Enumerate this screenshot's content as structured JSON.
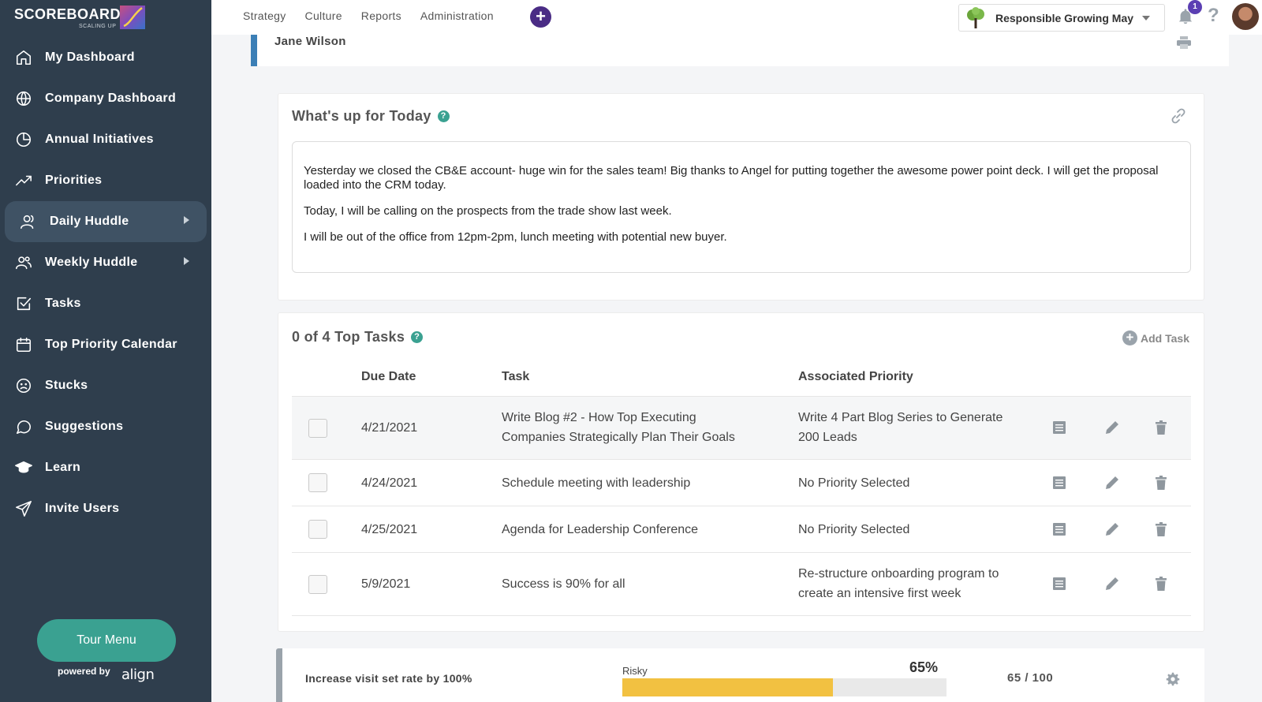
{
  "app": {
    "name": "SCOREBOARD",
    "sub": "SCALING UP",
    "powered_by": "powered by",
    "powered_brand": "align"
  },
  "sidebar": {
    "items": [
      {
        "label": "My Dashboard",
        "icon": "home-icon"
      },
      {
        "label": "Company Dashboard",
        "icon": "globe-icon"
      },
      {
        "label": "Annual Initiatives",
        "icon": "pie-chart-icon"
      },
      {
        "label": "Priorities",
        "icon": "trending-up-icon"
      },
      {
        "label": "Daily Huddle",
        "icon": "user-icon",
        "active": true,
        "expandable": true
      },
      {
        "label": "Weekly Huddle",
        "icon": "users-icon",
        "expandable": true
      },
      {
        "label": "Tasks",
        "icon": "checkbox-icon"
      },
      {
        "label": "Top Priority Calendar",
        "icon": "calendar-icon"
      },
      {
        "label": "Stucks",
        "icon": "frown-icon"
      },
      {
        "label": "Suggestions",
        "icon": "chat-icon"
      },
      {
        "label": "Learn",
        "icon": "graduation-cap-icon"
      },
      {
        "label": "Invite Users",
        "icon": "send-icon"
      }
    ],
    "tour_button": "Tour Menu"
  },
  "topbar": {
    "nav": [
      "Strategy",
      "Culture",
      "Reports",
      "Administration"
    ],
    "company": "Responsible Growing May",
    "notifications": "1",
    "help": "?"
  },
  "header": {
    "name": "Jane Wilson"
  },
  "today": {
    "title": "What's up for Today",
    "help": "?",
    "paragraphs": [
      "Yesterday we closed the CB&E account- huge win for the sales team! Big thanks to Angel for putting together the awesome power point deck. I will get the proposal loaded into the CRM today.",
      "Today, I will be calling on the prospects from the trade show last week.",
      "I will be out of the office from 12pm-2pm, lunch meeting with potential new buyer."
    ]
  },
  "tasks": {
    "title": "0 of 4 Top Tasks",
    "help": "?",
    "add_label": "Add Task",
    "columns": {
      "due": "Due Date",
      "task": "Task",
      "priority": "Associated Priority"
    },
    "rows": [
      {
        "due": "4/21/2021",
        "task": "Write Blog #2 - How Top Executing Companies Strategically Plan Their Goals",
        "priority": "Write 4 Part Blog Series to Generate 200 Leads"
      },
      {
        "due": "4/24/2021",
        "task": "Schedule meeting with leadership",
        "priority": "No Priority Selected"
      },
      {
        "due": "4/25/2021",
        "task": "Agenda for Leadership Conference",
        "priority": "No Priority Selected"
      },
      {
        "due": "5/9/2021",
        "task": "Success is 90% for all",
        "priority": "Re-structure onboarding program to create an intensive first week"
      }
    ]
  },
  "kpi": {
    "name": "Increase visit set rate by 100%",
    "status": "Risky",
    "percent_label": "65%",
    "progress": 0.65,
    "score": "65 / 100",
    "bar_color": "#f2c141"
  },
  "colors": {
    "sidebar": "#2f3e4d",
    "accent": "#3aa191",
    "brand_purple": "#4a2c85",
    "header_border": "#3c7fb6"
  }
}
